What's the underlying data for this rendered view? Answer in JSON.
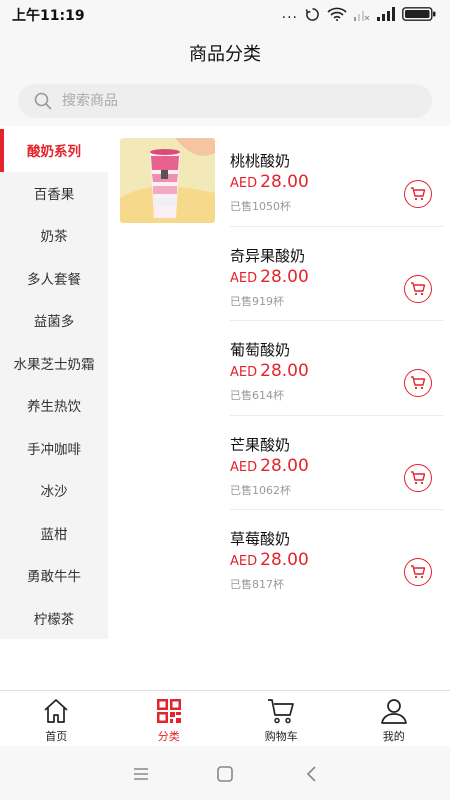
{
  "status_bar": {
    "time": "上午11:19",
    "dots": "..."
  },
  "header": {
    "title": "商品分类"
  },
  "search": {
    "placeholder": "搜索商品"
  },
  "sidebar": {
    "items": [
      {
        "label": "酸奶系列",
        "active": true
      },
      {
        "label": "百香果"
      },
      {
        "label": "奶茶"
      },
      {
        "label": "多人套餐"
      },
      {
        "label": "益菌多"
      },
      {
        "label": "水果芝士奶霜"
      },
      {
        "label": "养生热饮"
      },
      {
        "label": "手冲咖啡"
      },
      {
        "label": "冰沙"
      },
      {
        "label": "蓝柑"
      },
      {
        "label": "勇敢牛牛"
      },
      {
        "label": "柠檬茶"
      }
    ]
  },
  "products": [
    {
      "name": "桃桃酸奶",
      "currency": "AED",
      "price": "28.00",
      "sold": "已售1050杯",
      "has_image": true
    },
    {
      "name": "奇异果酸奶",
      "currency": "AED",
      "price": "28.00",
      "sold": "已售919杯"
    },
    {
      "name": "葡萄酸奶",
      "currency": "AED",
      "price": "28.00",
      "sold": "已售614杯"
    },
    {
      "name": "芒果酸奶",
      "currency": "AED",
      "price": "28.00",
      "sold": "已售1062杯"
    },
    {
      "name": "草莓酸奶",
      "currency": "AED",
      "price": "28.00",
      "sold": "已售817杯"
    }
  ],
  "bottom_nav": {
    "items": [
      {
        "label": "首页",
        "icon": "home-icon"
      },
      {
        "label": "分类",
        "icon": "category-icon",
        "active": true
      },
      {
        "label": "购物车",
        "icon": "cart-icon"
      },
      {
        "label": "我的",
        "icon": "user-icon"
      }
    ]
  },
  "colors": {
    "accent": "#e3242b",
    "background": "#f7f7f7",
    "sidebar": "#f4f4f4"
  }
}
